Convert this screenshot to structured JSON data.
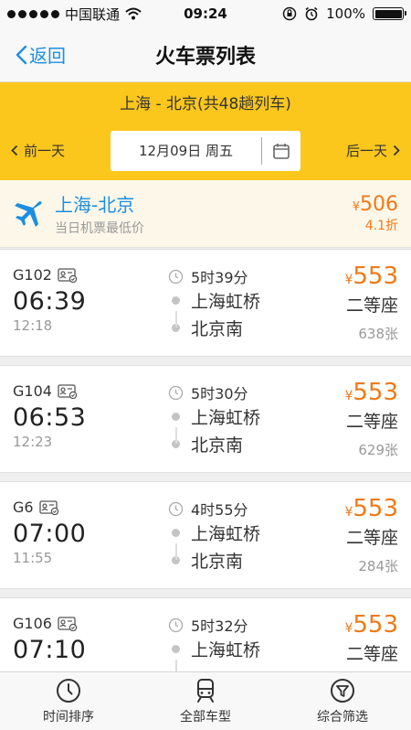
{
  "status_bar": {
    "carrier": "中国联通",
    "time": "09:24",
    "battery": "100%"
  },
  "nav": {
    "back_label": "返回",
    "title": "火车票列表"
  },
  "route": {
    "title": "上海 - 北京(共48趟列车)",
    "prev_label": "前一天",
    "next_label": "后一天",
    "date": "12月09日  周五"
  },
  "flight": {
    "route": "上海-北京",
    "subtitle": "当日机票最低价",
    "currency": "¥",
    "price": "506",
    "discount": "4.1折"
  },
  "trains": [
    {
      "code": "G102",
      "depart": "06:39",
      "arrive": "12:18",
      "duration": "5时39分",
      "from": "上海虹桥",
      "to": "北京南",
      "currency": "¥",
      "price": "553",
      "seat": "二等座",
      "count": "638张"
    },
    {
      "code": "G104",
      "depart": "06:53",
      "arrive": "12:23",
      "duration": "5时30分",
      "from": "上海虹桥",
      "to": "北京南",
      "currency": "¥",
      "price": "553",
      "seat": "二等座",
      "count": "629张"
    },
    {
      "code": "G6",
      "depart": "07:00",
      "arrive": "11:55",
      "duration": "4时55分",
      "from": "上海虹桥",
      "to": "北京南",
      "currency": "¥",
      "price": "553",
      "seat": "二等座",
      "count": "284张"
    },
    {
      "code": "G106",
      "depart": "07:10",
      "arrive": "",
      "duration": "5时32分",
      "from": "上海虹桥",
      "to": "",
      "currency": "¥",
      "price": "553",
      "seat": "二等座",
      "count": ""
    }
  ],
  "tabs": [
    {
      "label": "时间排序",
      "icon": "clock-icon"
    },
    {
      "label": "全部车型",
      "icon": "train-icon"
    },
    {
      "label": "综合筛选",
      "icon": "filter-icon"
    }
  ],
  "colors": {
    "accent_blue": "#1a8fe3",
    "band_yellow": "#fbc71c",
    "price_orange": "#f07a17"
  }
}
